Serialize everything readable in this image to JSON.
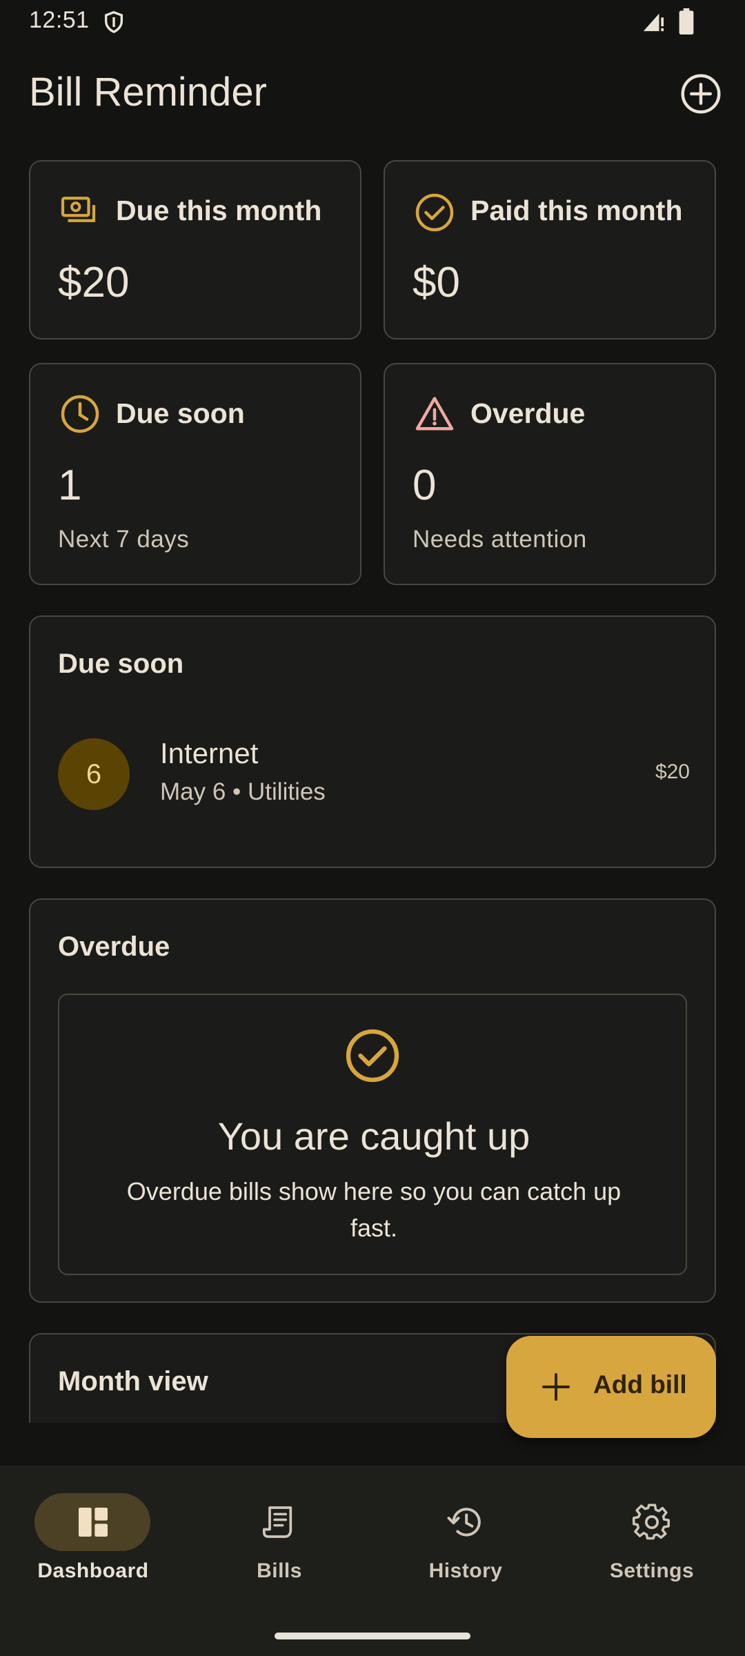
{
  "status_bar": {
    "time": "12:51"
  },
  "app": {
    "title": "Bill Reminder"
  },
  "stats": {
    "due_this_month": {
      "label": "Due this month",
      "value": "$20"
    },
    "paid_this_month": {
      "label": "Paid this month",
      "value": "$0"
    },
    "due_soon": {
      "label": "Due soon",
      "value": "1",
      "sub": "Next 7 days"
    },
    "overdue": {
      "label": "Overdue",
      "value": "0",
      "sub": "Needs attention"
    }
  },
  "due_soon_section": {
    "title": "Due soon",
    "items": [
      {
        "day": "6",
        "name": "Internet",
        "meta": "May 6 • Utilities",
        "amount": "$20"
      }
    ]
  },
  "overdue_section": {
    "title": "Overdue",
    "empty_title": "You are caught up",
    "empty_desc": "Overdue bills show here so you can catch up fast."
  },
  "month_view": {
    "title": "Month view"
  },
  "fab": {
    "label": "Add bill"
  },
  "nav": [
    {
      "label": "Dashboard",
      "icon": "dashboard-icon",
      "active": true
    },
    {
      "label": "Bills",
      "icon": "receipt-icon",
      "active": false
    },
    {
      "label": "History",
      "icon": "history-icon",
      "active": false
    },
    {
      "label": "Settings",
      "icon": "gear-icon",
      "active": false
    }
  ],
  "colors": {
    "accent": "#d7a63e",
    "warning": "#f0a8a0",
    "background": "#131312",
    "card": "#1b1b19"
  }
}
